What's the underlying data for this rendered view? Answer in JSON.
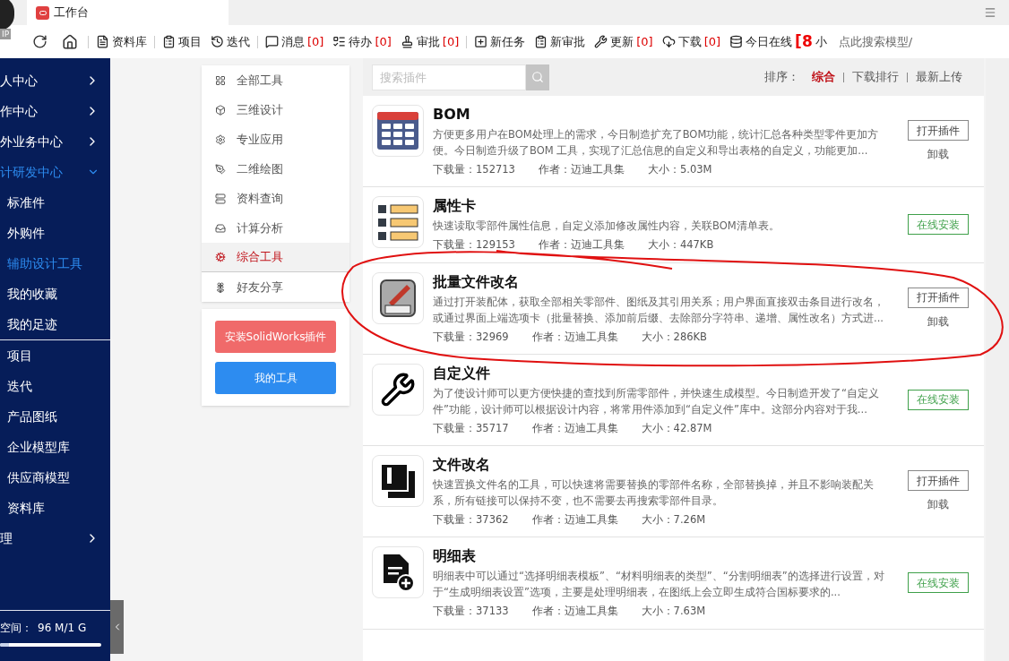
{
  "browser": {
    "avatar_badge": "IP",
    "tab": {
      "title": "工作台"
    }
  },
  "toolbar": {
    "items": [
      {
        "kind": "refresh"
      },
      {
        "kind": "home"
      },
      {
        "kind": "link",
        "label": "资料库"
      },
      {
        "kind": "link",
        "label": "项目"
      },
      {
        "kind": "link",
        "label": "迭代"
      },
      {
        "kind": "link",
        "label": "消息",
        "count": "[0]"
      },
      {
        "kind": "link",
        "label": "待办",
        "count": "[0]"
      },
      {
        "kind": "link",
        "label": "审批",
        "count": "[0]"
      },
      {
        "kind": "link",
        "label": "新任务"
      },
      {
        "kind": "link",
        "label": "新审批"
      },
      {
        "kind": "link",
        "label": "更新",
        "count": "[0]"
      },
      {
        "kind": "link",
        "label": "下载",
        "count": "[0]"
      },
      {
        "kind": "online",
        "label": "今日在线",
        "count": "[8",
        "suffix": "小"
      },
      {
        "kind": "search",
        "label": "点此搜索模型/"
      }
    ]
  },
  "sidebar": {
    "sections": [
      {
        "items": [
          {
            "kind": "group",
            "label": "人中心",
            "expanded": false
          },
          {
            "kind": "group",
            "label": "作中心",
            "expanded": false
          },
          {
            "kind": "group",
            "label": "外业务中心",
            "expanded": false
          },
          {
            "kind": "group",
            "label": "计研发中心",
            "expanded": true,
            "children": [
              {
                "label": "标准件",
                "selected": false
              },
              {
                "label": "外购件",
                "selected": false
              },
              {
                "label": "辅助设计工具",
                "selected": true
              },
              {
                "label": "我的收藏",
                "selected": false
              },
              {
                "label": "我的足迹",
                "selected": false
              }
            ]
          }
        ]
      },
      {
        "items": [
          {
            "kind": "link",
            "label": "项目"
          },
          {
            "kind": "link",
            "label": "迭代"
          },
          {
            "kind": "link",
            "label": "产品图纸"
          },
          {
            "kind": "link",
            "label": "企业模型库"
          },
          {
            "kind": "link",
            "label": "供应商模型"
          },
          {
            "kind": "link",
            "label": "资料库"
          },
          {
            "kind": "group",
            "label": "理",
            "expanded": false
          }
        ]
      }
    ],
    "storage": {
      "label": "空间：",
      "value": "96 M/1 G",
      "level": 0.09
    }
  },
  "categories": [
    {
      "label": "全部工具",
      "selected": false
    },
    {
      "label": "三维设计",
      "selected": false
    },
    {
      "label": "专业应用",
      "selected": false
    },
    {
      "label": "二维绘图",
      "selected": false
    },
    {
      "label": "资料查询",
      "selected": false
    },
    {
      "label": "计算分析",
      "selected": false
    },
    {
      "label": "综合工具",
      "selected": true
    },
    {
      "label": "好友分享",
      "selected": false
    }
  ],
  "actions": [
    {
      "kind": "install",
      "label": "安装SolidWorks插件"
    },
    {
      "kind": "mine",
      "label": "我的工具"
    }
  ],
  "search": {
    "placeholder": "搜索插件"
  },
  "sort": {
    "label": "排序：",
    "options": [
      {
        "label": "综合",
        "selected": true
      },
      {
        "label": "下载排行",
        "selected": false
      },
      {
        "label": "最新上传",
        "selected": false
      }
    ]
  },
  "plugins": [
    {
      "title": "BOM",
      "description": "方便更多用户在BOM处理上的需求，今日制造扩充了BOM功能，统计汇总各种类型零件更加方便。今日制造升级了BOM 工具，实现了汇总信息的自定义和导出表格的自定义，功能更加...",
      "downloads": "下载量：152713",
      "author": "作者：迈迪工具集",
      "size": "大小：5.03M",
      "installed": true,
      "primary": "打开插件",
      "secondary": "卸载"
    },
    {
      "title": "属性卡",
      "description": "快速读取零部件属性信息，自定义添加修改属性内容，关联BOM清单表。",
      "downloads": "下载量：129153",
      "author": "作者：迈迪工具集",
      "size": "大小：447KB",
      "installed": false,
      "primary": "在线安装"
    },
    {
      "title": "批量文件改名",
      "description": "通过打开装配体，获取全部相关零部件、图纸及其引用关系；用户界面直接双击条目进行改名，或通过界面上端选项卡（批量替换、添加前后缀、去除部分字符串、递增、属性改名）方式进...",
      "downloads": "下载量：32969",
      "author": "作者：迈迪工具集",
      "size": "大小：286KB",
      "installed": true,
      "primary": "打开插件",
      "secondary": "卸载"
    },
    {
      "title": "自定义件",
      "description": "为了使设计师可以更方便快捷的查找到所需零部件，并快速生成模型。今日制造开发了“自定义件”功能，设计师可以根据设计内容，将常用件添加到“自定义件”库中。这部分内容对于我...",
      "downloads": "下载量：35717",
      "author": "作者：迈迪工具集",
      "size": "大小：42.87M",
      "installed": false,
      "primary": "在线安装"
    },
    {
      "title": "文件改名",
      "description": "快速置换文件名的工具，可以快速将需要替换的零部件名称，全部替换掉，并且不影响装配关系，所有链接可以保持不变，也不需要去再搜索零部件目录。",
      "downloads": "下载量：37362",
      "author": "作者：迈迪工具集",
      "size": "大小：7.26M",
      "installed": true,
      "primary": "打开插件",
      "secondary": "卸载"
    },
    {
      "title": "明细表",
      "description": "明细表中可以通过“选择明细表模板”、“材料明细表的类型”、“分割明细表”的选择进行设置，对于“生成明细表设置”选项，主要是处理明细表，在图纸上会立即生成符合国标要求的...",
      "downloads": "下载量：37133",
      "author": "作者：迈迪工具集",
      "size": "大小：7.63M",
      "installed": false,
      "primary": "在线安装"
    }
  ]
}
